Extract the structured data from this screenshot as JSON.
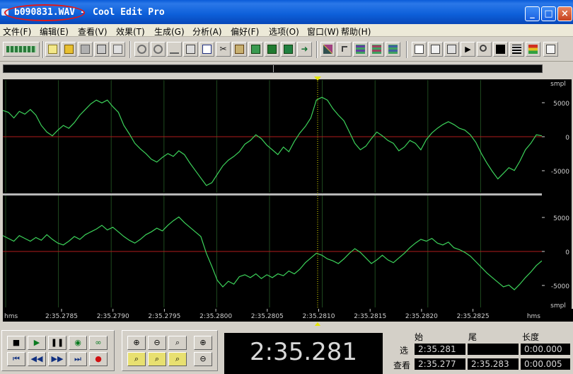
{
  "window": {
    "file_name": "b090831.WAV",
    "separator": "-",
    "app_name": "Cool Edit Pro",
    "minimize": "_",
    "maximize": "□",
    "close": "×"
  },
  "menu": [
    "文件(F)",
    "编辑(E)",
    "查看(V)",
    "效果(T)",
    "生成(G)",
    "分析(A)",
    "偏好(F)",
    "选项(O)",
    "窗口(W)",
    "帮助(H)"
  ],
  "waveform": {
    "unit_label": "smpl",
    "y_ticks": [
      "5000",
      "0",
      "-5000"
    ],
    "time_axis_label": "hms",
    "time_ticks": [
      "2:35.2785",
      "2:35.2790",
      "2:35.2795",
      "2:35.2800",
      "2:35.2805",
      "2:35.2810",
      "2:35.2815",
      "2:35.2820",
      "2:35.2825"
    ],
    "colors": {
      "background": "#000000",
      "wave": "#3cd25a",
      "zero_line": "#b01c1c",
      "grid": "#1f4a1f",
      "cursor": "#e6e600"
    },
    "channels": [
      {
        "name": "left",
        "points": [
          [
            0,
            2800
          ],
          [
            2,
            2600
          ],
          [
            4,
            2000
          ],
          [
            6,
            2700
          ],
          [
            8,
            2400
          ],
          [
            10,
            2900
          ],
          [
            12,
            2300
          ],
          [
            14,
            1200
          ],
          [
            16,
            500
          ],
          [
            18,
            100
          ],
          [
            20,
            700
          ],
          [
            22,
            1200
          ],
          [
            24,
            900
          ],
          [
            26,
            1500
          ],
          [
            28,
            2300
          ],
          [
            30,
            2900
          ],
          [
            32,
            3500
          ],
          [
            34,
            3900
          ],
          [
            36,
            3600
          ],
          [
            38,
            3900
          ],
          [
            40,
            3200
          ],
          [
            42,
            2600
          ],
          [
            44,
            1200
          ],
          [
            46,
            300
          ],
          [
            48,
            -700
          ],
          [
            50,
            -1300
          ],
          [
            52,
            -1800
          ],
          [
            54,
            -2400
          ],
          [
            56,
            -2700
          ],
          [
            58,
            -2200
          ],
          [
            60,
            -1800
          ],
          [
            62,
            -2100
          ],
          [
            64,
            -1500
          ],
          [
            66,
            -1900
          ],
          [
            68,
            -2800
          ],
          [
            70,
            -3600
          ],
          [
            72,
            -4400
          ],
          [
            74,
            -5200
          ],
          [
            76,
            -4900
          ],
          [
            78,
            -4000
          ],
          [
            80,
            -3100
          ],
          [
            82,
            -2500
          ],
          [
            84,
            -2100
          ],
          [
            86,
            -1600
          ],
          [
            88,
            -800
          ],
          [
            90,
            -400
          ],
          [
            92,
            200
          ],
          [
            94,
            -200
          ],
          [
            96,
            -900
          ],
          [
            98,
            -1400
          ],
          [
            100,
            -1900
          ],
          [
            102,
            -1100
          ],
          [
            104,
            -1600
          ],
          [
            106,
            -500
          ],
          [
            108,
            400
          ],
          [
            110,
            1100
          ],
          [
            112,
            2000
          ],
          [
            114,
            3900
          ],
          [
            116,
            4200
          ],
          [
            118,
            3900
          ],
          [
            120,
            3000
          ],
          [
            122,
            2300
          ],
          [
            124,
            1700
          ],
          [
            126,
            500
          ],
          [
            128,
            -700
          ],
          [
            130,
            -1400
          ],
          [
            132,
            -1000
          ],
          [
            134,
            -200
          ],
          [
            136,
            500
          ],
          [
            138,
            100
          ],
          [
            140,
            -400
          ],
          [
            142,
            -700
          ],
          [
            144,
            -1500
          ],
          [
            146,
            -1100
          ],
          [
            148,
            -400
          ],
          [
            150,
            -700
          ],
          [
            152,
            -1400
          ],
          [
            154,
            -300
          ],
          [
            156,
            400
          ],
          [
            158,
            900
          ],
          [
            160,
            1300
          ],
          [
            162,
            1600
          ],
          [
            164,
            1300
          ],
          [
            166,
            900
          ],
          [
            168,
            700
          ],
          [
            170,
            200
          ],
          [
            172,
            -600
          ],
          [
            174,
            -1800
          ],
          [
            176,
            -2800
          ],
          [
            178,
            -3700
          ],
          [
            180,
            -4500
          ],
          [
            182,
            -3900
          ],
          [
            184,
            -3300
          ],
          [
            186,
            -3600
          ],
          [
            188,
            -2600
          ],
          [
            190,
            -1400
          ],
          [
            192,
            -700
          ],
          [
            194,
            200
          ],
          [
            196,
            100
          ]
        ]
      },
      {
        "name": "right",
        "points": [
          [
            0,
            1700
          ],
          [
            2,
            1400
          ],
          [
            4,
            1100
          ],
          [
            6,
            1700
          ],
          [
            8,
            1400
          ],
          [
            10,
            1100
          ],
          [
            12,
            1500
          ],
          [
            14,
            1200
          ],
          [
            16,
            1800
          ],
          [
            18,
            1300
          ],
          [
            20,
            900
          ],
          [
            22,
            700
          ],
          [
            24,
            1100
          ],
          [
            26,
            1600
          ],
          [
            28,
            1300
          ],
          [
            30,
            1800
          ],
          [
            32,
            2100
          ],
          [
            34,
            2400
          ],
          [
            36,
            2800
          ],
          [
            38,
            2300
          ],
          [
            40,
            2600
          ],
          [
            42,
            2100
          ],
          [
            44,
            1600
          ],
          [
            46,
            1200
          ],
          [
            48,
            900
          ],
          [
            50,
            1300
          ],
          [
            52,
            1800
          ],
          [
            54,
            2100
          ],
          [
            56,
            2500
          ],
          [
            58,
            2200
          ],
          [
            60,
            2800
          ],
          [
            62,
            3300
          ],
          [
            64,
            3700
          ],
          [
            66,
            3100
          ],
          [
            68,
            2600
          ],
          [
            70,
            2100
          ],
          [
            72,
            1600
          ],
          [
            74,
            -200
          ],
          [
            76,
            -1600
          ],
          [
            78,
            -3100
          ],
          [
            80,
            -3800
          ],
          [
            82,
            -3200
          ],
          [
            84,
            -3500
          ],
          [
            86,
            -2700
          ],
          [
            88,
            -2500
          ],
          [
            90,
            -2800
          ],
          [
            92,
            -2400
          ],
          [
            94,
            -2900
          ],
          [
            96,
            -2500
          ],
          [
            98,
            -2800
          ],
          [
            100,
            -2400
          ],
          [
            102,
            -2600
          ],
          [
            104,
            -2100
          ],
          [
            106,
            -2400
          ],
          [
            108,
            -1900
          ],
          [
            110,
            -1200
          ],
          [
            112,
            -700
          ],
          [
            114,
            -200
          ],
          [
            116,
            -400
          ],
          [
            118,
            -800
          ],
          [
            120,
            -1000
          ],
          [
            122,
            -1300
          ],
          [
            124,
            -800
          ],
          [
            126,
            -200
          ],
          [
            128,
            300
          ],
          [
            130,
            -100
          ],
          [
            132,
            -700
          ],
          [
            134,
            -1300
          ],
          [
            136,
            -900
          ],
          [
            138,
            -400
          ],
          [
            140,
            -900
          ],
          [
            142,
            -1200
          ],
          [
            144,
            -700
          ],
          [
            146,
            -200
          ],
          [
            148,
            400
          ],
          [
            150,
            900
          ],
          [
            152,
            1300
          ],
          [
            154,
            1100
          ],
          [
            156,
            1400
          ],
          [
            158,
            900
          ],
          [
            160,
            700
          ],
          [
            162,
            1000
          ],
          [
            164,
            400
          ],
          [
            166,
            200
          ],
          [
            168,
            -100
          ],
          [
            170,
            -500
          ],
          [
            172,
            -1100
          ],
          [
            174,
            -1700
          ],
          [
            176,
            -2300
          ],
          [
            178,
            -2800
          ],
          [
            180,
            -3300
          ],
          [
            182,
            -3800
          ],
          [
            184,
            -3600
          ],
          [
            186,
            -4100
          ],
          [
            188,
            -3500
          ],
          [
            190,
            -2800
          ],
          [
            192,
            -2200
          ],
          [
            194,
            -1500
          ],
          [
            196,
            -1000
          ]
        ]
      }
    ]
  },
  "transport": {
    "time_display": "2:35.281",
    "headers": {
      "start": "始",
      "end": "尾",
      "length": "长度"
    },
    "rows": [
      {
        "label": "选",
        "start": "2:35.281",
        "end": "",
        "length": "0:00.000"
      },
      {
        "label": "查看",
        "start": "2:35.277",
        "end": "2:35.283",
        "length": "0:00.005"
      }
    ]
  }
}
